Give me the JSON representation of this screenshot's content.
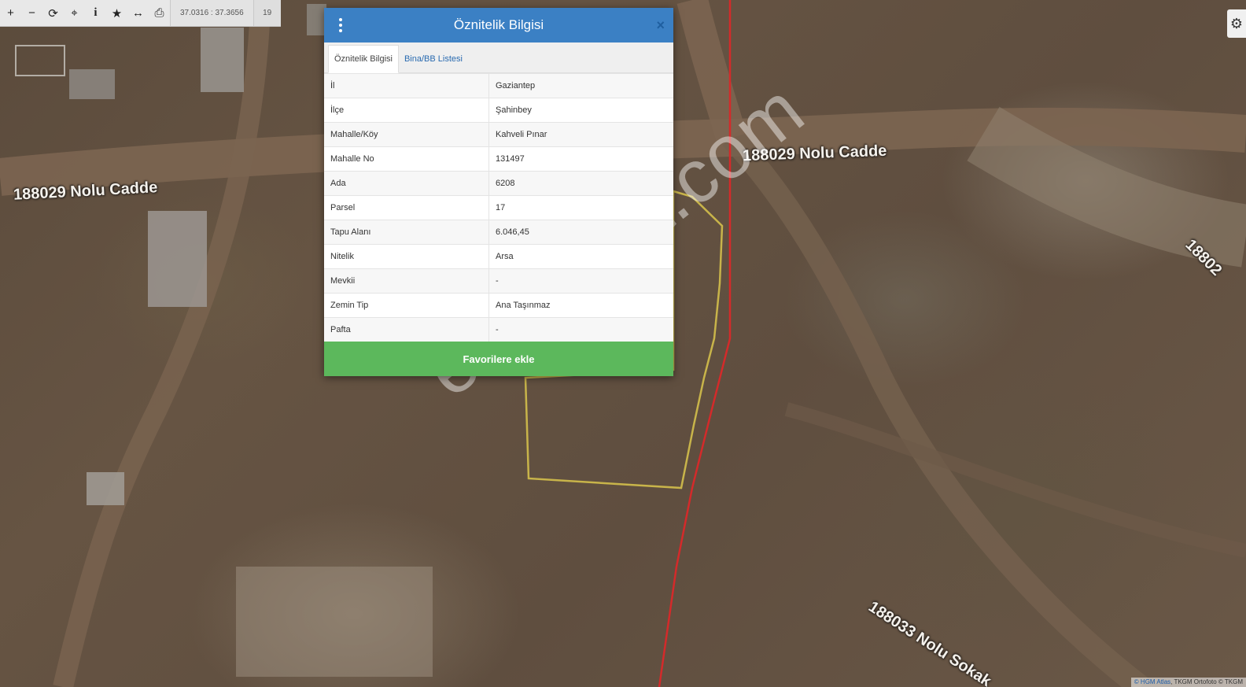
{
  "toolbar": {
    "tools": [
      {
        "icon": "plus-icon",
        "glyph": "+"
      },
      {
        "icon": "minus-icon",
        "glyph": "−"
      },
      {
        "icon": "refresh-icon",
        "glyph": "⟳"
      },
      {
        "icon": "locate-icon",
        "glyph": "⌖"
      },
      {
        "icon": "info-icon",
        "glyph": "i"
      },
      {
        "icon": "star-icon",
        "glyph": "★"
      },
      {
        "icon": "measure-icon",
        "glyph": "↔"
      },
      {
        "icon": "print-icon",
        "glyph": "⎙"
      }
    ],
    "coordinates": "37.0316 : 37.3656",
    "zoom_level": "19"
  },
  "map": {
    "road_labels": {
      "left": "188029 Nolu Cadde",
      "top_right": "188029 Nolu Cadde",
      "bottom_right": "188033 Nolu Sokak",
      "right_edge": "18802"
    },
    "watermark": "emlakjet.com",
    "attribution": {
      "link": "© HGM Atlas",
      "text": ", TKGM Ortofoto © TKGM"
    },
    "colors": {
      "parcel_outline": "#c8b44a",
      "boundary_line": "#d42a2a"
    }
  },
  "popup": {
    "title": "Öznitelik Bilgisi",
    "close_label": "×",
    "tabs": [
      "Öznitelik Bilgisi",
      "Bina/BB Listesi"
    ],
    "rows": [
      {
        "key": "İl",
        "value": "Gaziantep"
      },
      {
        "key": "İlçe",
        "value": "Şahinbey"
      },
      {
        "key": "Mahalle/Köy",
        "value": "Kahveli Pınar"
      },
      {
        "key": "Mahalle No",
        "value": "131497"
      },
      {
        "key": "Ada",
        "value": "6208"
      },
      {
        "key": "Parsel",
        "value": "17"
      },
      {
        "key": "Tapu Alanı",
        "value": "6.046,45"
      },
      {
        "key": "Nitelik",
        "value": "Arsa"
      },
      {
        "key": "Mevkii",
        "value": "-"
      },
      {
        "key": "Zemin Tip",
        "value": "Ana Taşınmaz"
      },
      {
        "key": "Pafta",
        "value": "-"
      }
    ],
    "favorite_button": "Favorilere ekle",
    "header_color": "#3b80c4",
    "button_color": "#5cb85c"
  }
}
